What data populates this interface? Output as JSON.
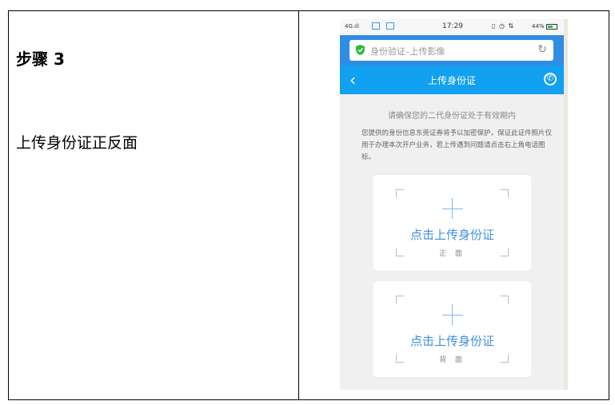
{
  "document": {
    "step_title": "步骤 3",
    "step_description": "上传身份证正反面"
  },
  "screenshot": {
    "status_bar": {
      "signal": "4G.ıll",
      "time": "17:29",
      "battery": "44%",
      "battery_color": "#2dbb3e"
    },
    "address_bar": {
      "url_text": "身份验证–上传影像",
      "secure_icon": "shield-check-icon",
      "refresh_icon": "refresh-icon"
    },
    "nav": {
      "title": "上传身份证",
      "back_icon": "chevron-left-icon",
      "call_icon": "phone-icon",
      "color": "#12a0f0"
    },
    "notice": "请确保您的二代身份证处于有效期内",
    "info": "您提供的身份信息东莞证券将予以加密保护，保证此证件照片仅用于办理本次开户业务，若上传遇到问题请点击右上角电话图标。",
    "cards": [
      {
        "label": "点击上传身份证",
        "side": "正 面"
      },
      {
        "label": "点击上传身份证",
        "side": "背 面"
      }
    ],
    "accent": "#3f8fe0"
  }
}
